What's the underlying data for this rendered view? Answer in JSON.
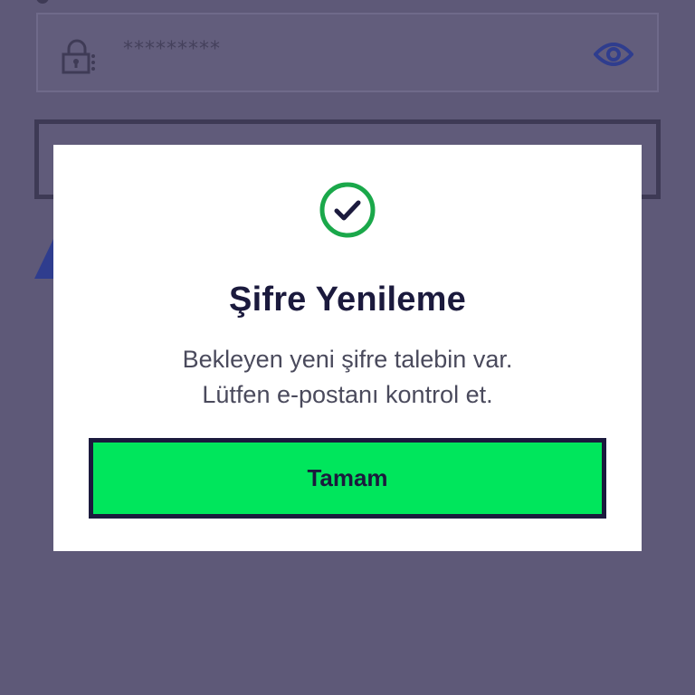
{
  "background_form": {
    "password_value": "*********"
  },
  "modal": {
    "title": "Şifre Yenileme",
    "message_line1": "Bekleyen yeni şifre talebin var.",
    "message_line2": "Lütfen e-postanı kontrol et.",
    "ok_label": "Tamam",
    "icon": "check-circle-icon"
  },
  "colors": {
    "overlay": "#5e5978",
    "accent_green": "#00e65c",
    "success_icon": "#1aa84a",
    "text_dark": "#1b1a3d",
    "eye_icon": "#2f3d8e"
  }
}
